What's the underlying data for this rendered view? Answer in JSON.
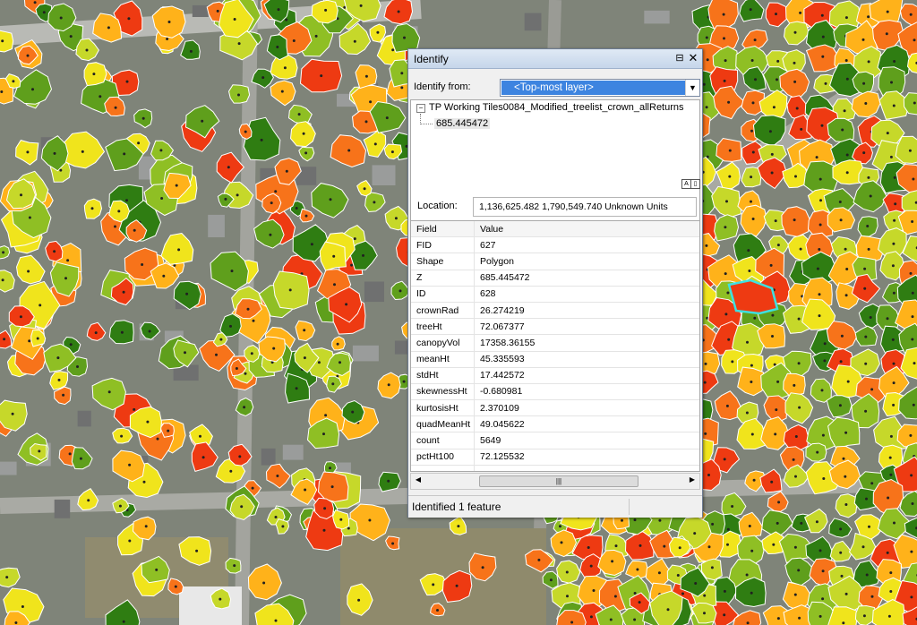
{
  "window": {
    "title": "Identify",
    "pin_glyph": "⊟",
    "close_glyph": "✕"
  },
  "identify_from": {
    "label": "Identify from:",
    "value": "<Top-most layer>"
  },
  "tree": {
    "layer_name": "TP Working Tiles0084_Modified_treelist_crown_allReturns",
    "feature_value": "685.445472"
  },
  "location": {
    "label": "Location:",
    "value": "1,136,625.482  1,790,549.740 Unknown Units"
  },
  "attributes": {
    "header_field": "Field",
    "header_value": "Value",
    "rows": [
      {
        "field": "FID",
        "value": "627"
      },
      {
        "field": "Shape",
        "value": "Polygon"
      },
      {
        "field": "Z",
        "value": "685.445472"
      },
      {
        "field": "ID",
        "value": "628"
      },
      {
        "field": "crownRad",
        "value": "26.274219"
      },
      {
        "field": "treeHt",
        "value": "72.067377"
      },
      {
        "field": "canopyVol",
        "value": "17358.36155"
      },
      {
        "field": "meanHt",
        "value": "45.335593"
      },
      {
        "field": "stdHt",
        "value": "17.442572"
      },
      {
        "field": "skewnessHt",
        "value": "-0.680981"
      },
      {
        "field": "kurtosisHt",
        "value": "2.370109"
      },
      {
        "field": "quadMeanHt",
        "value": "49.045622"
      },
      {
        "field": "count",
        "value": "5649"
      },
      {
        "field": "pctHt100",
        "value": "72.125532"
      }
    ]
  },
  "status": {
    "text": "Identified 1 feature"
  },
  "map": {
    "crown_colors": [
      "#2f7d12",
      "#5f9f1c",
      "#8fbf24",
      "#c6d82a",
      "#f0e41c",
      "#ffb21a",
      "#f7731a",
      "#ee3a12"
    ],
    "selected_outline": "#3fe0e0",
    "selected_fill": "#ee3a12"
  }
}
